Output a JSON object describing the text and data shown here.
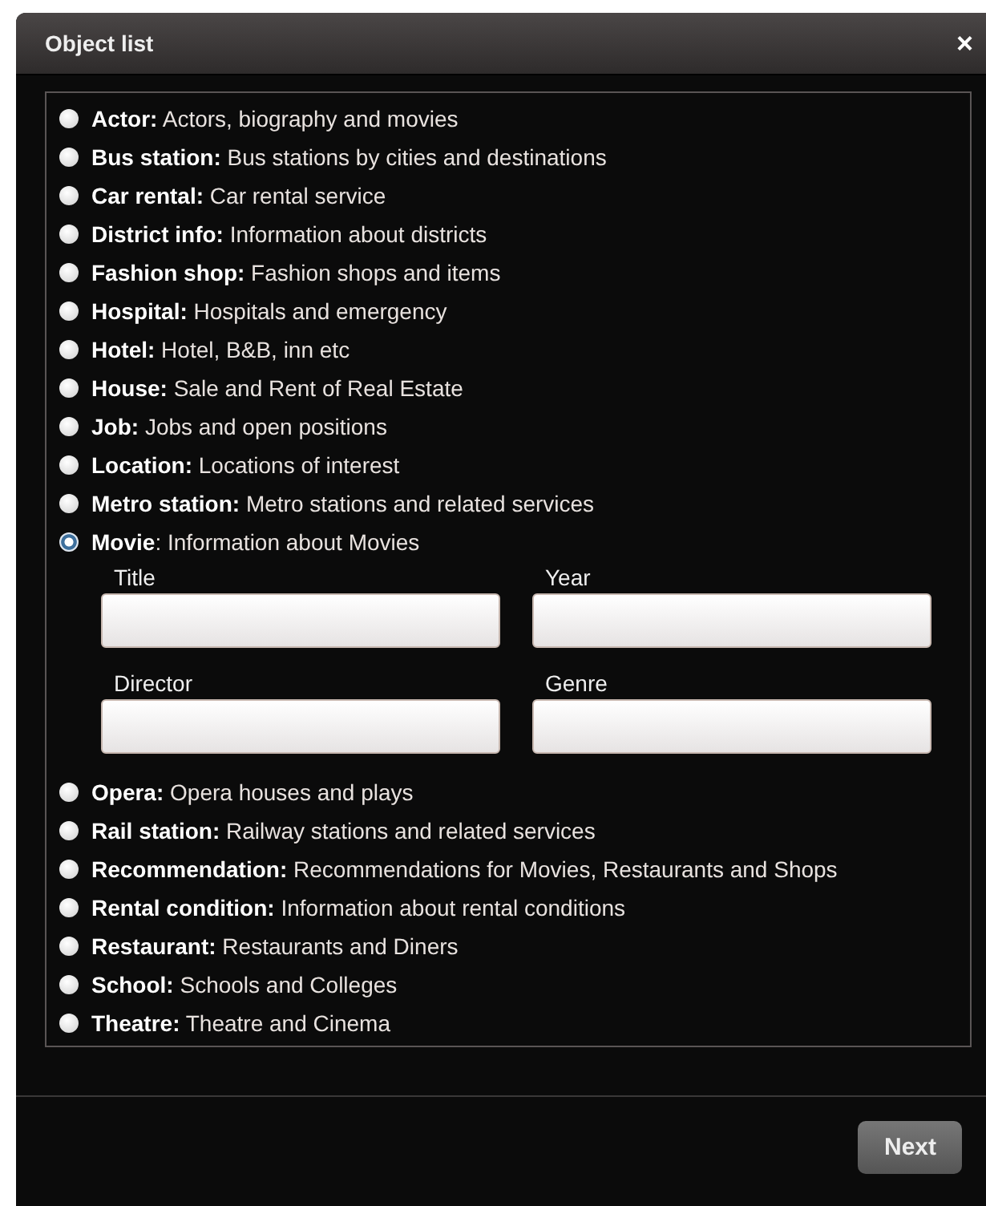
{
  "window": {
    "title": "Object list",
    "close": "×"
  },
  "options": [
    {
      "label": "**Actor:** Actors, biography and movies",
      "selected": false
    },
    {
      "label": "**Bus station:** Bus stations by cities and destinations",
      "selected": false
    },
    {
      "label": "**Car rental:** Car rental service",
      "selected": false
    },
    {
      "label": "**District info:** Information about districts",
      "selected": false
    },
    {
      "label": "**Fashion shop:** Fashion shops and items",
      "selected": false
    },
    {
      "label": "**Hospital:** Hospitals and emergency",
      "selected": false
    },
    {
      "label": "**Hotel:** Hotel, B&B, inn etc",
      "selected": false
    },
    {
      "label": "**House:** Sale and Rent of Real Estate",
      "selected": false
    },
    {
      "label": "**Job:** Jobs and open positions",
      "selected": false
    },
    {
      "label": "**Location:** Locations of interest",
      "selected": false
    },
    {
      "label": "**Metro station:** Metro stations and related services",
      "selected": false
    },
    {
      "label": "**Movie**: Information about Movies",
      "selected": true,
      "fields": [
        {
          "label": "Title"
        },
        {
          "label": "Year"
        },
        {
          "label": "Director"
        },
        {
          "label": "Genre"
        }
      ]
    },
    {
      "label": "**Opera:** Opera houses and plays",
      "selected": false
    },
    {
      "label": "**Rail station:** Railway stations and related services",
      "selected": false
    },
    {
      "label": "**Recommendation:** Recommendations for Movies, Restaurants and Shops",
      "selected": false
    },
    {
      "label": "**Rental condition:** Information about rental conditions",
      "selected": false
    },
    {
      "label": "**Restaurant:** Restaurants and Diners",
      "selected": false
    },
    {
      "label": "**School:** Schools and Colleges",
      "selected": false
    },
    {
      "label": "**Theatre:** Theatre and Cinema",
      "selected": false
    }
  ],
  "buttons": [
    {
      "label": "Next"
    }
  ]
}
